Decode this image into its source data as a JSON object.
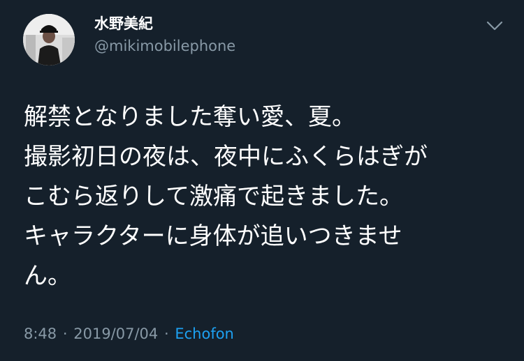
{
  "user": {
    "display_name": "水野美紀",
    "handle": "@mikimobilephone"
  },
  "tweet": {
    "lines": [
      "解禁となりました奪い愛、夏。",
      "撮影初日の夜は、夜中にふくらはぎが",
      "こむら返りして激痛で起きました。",
      "キャラクターに身体が追いつきませ",
      "ん。"
    ]
  },
  "meta": {
    "time": "8:48",
    "separator": "·",
    "date": "2019/07/04",
    "source": "Echofon"
  },
  "icons": {
    "menu": "chevron-down-icon",
    "avatar": "profile-photo"
  },
  "colors": {
    "background": "#15202b",
    "text": "#ffffff",
    "secondary_text": "#8899a6",
    "link": "#1da1f2"
  }
}
